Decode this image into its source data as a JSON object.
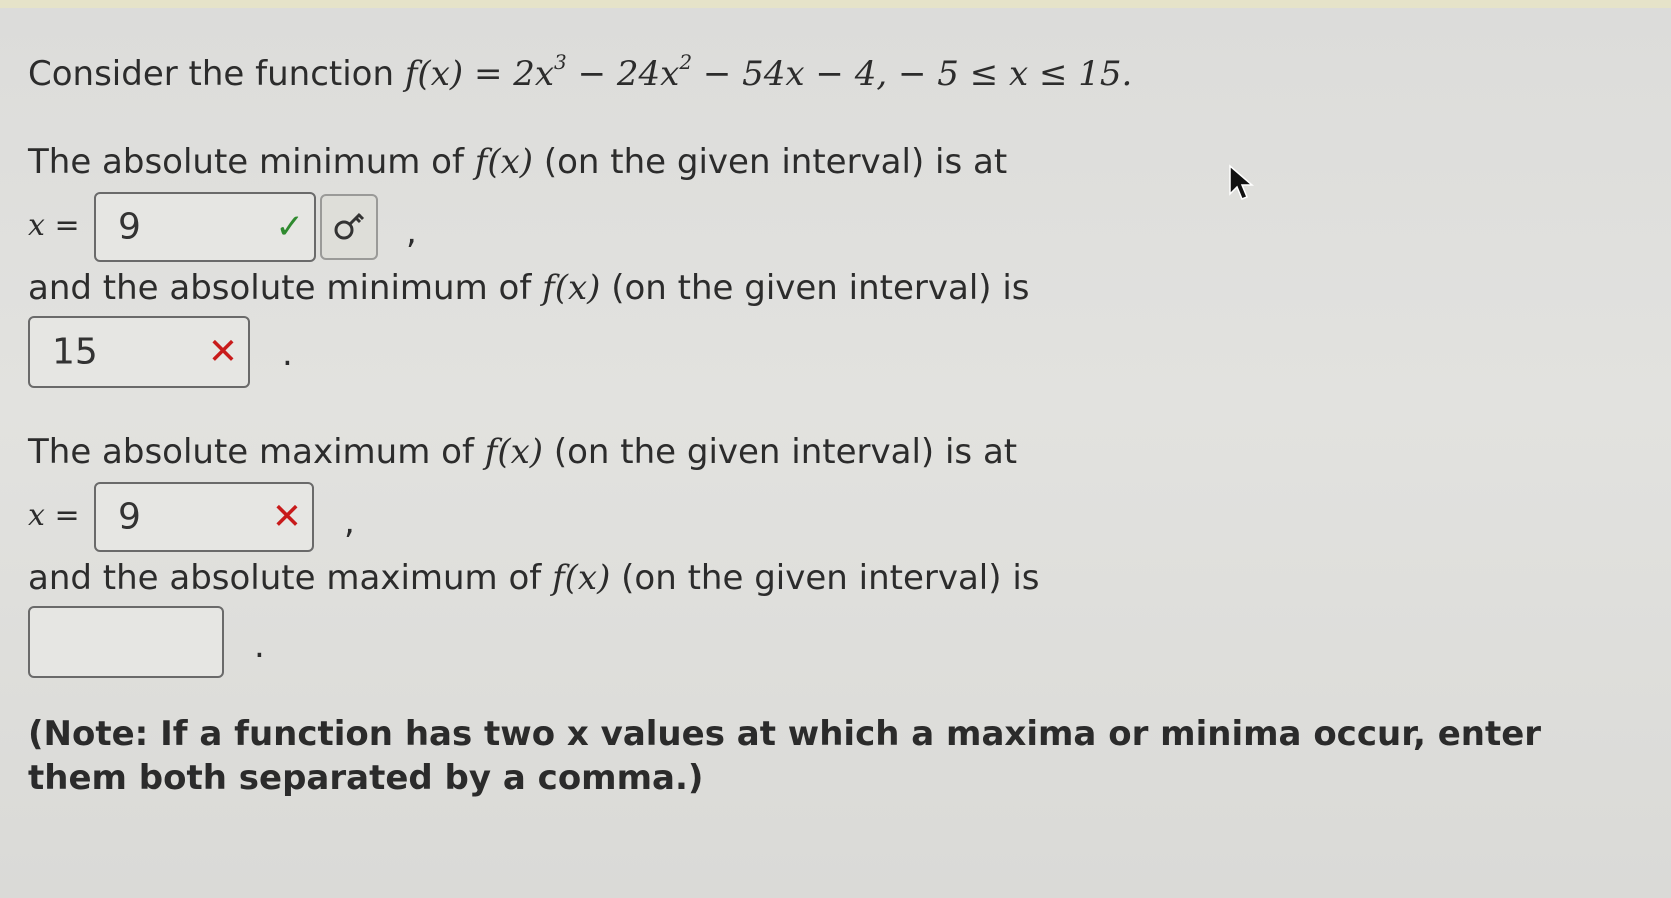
{
  "intro": {
    "prefix": "Consider the function ",
    "fx": "f(x) = 2x",
    "exp1": "3",
    "mid1": " − 24x",
    "exp2": "2",
    "mid2": " − 54x − 4,   − 5 ≤ x ≤ 15."
  },
  "q1": {
    "text_before": "The absolute minimum of ",
    "fx": "f(x)",
    "text_after": " (on the given interval) is at",
    "x_label": "x",
    "equals": " =",
    "answer": "9",
    "status_mark": "✓",
    "key_icon": "key-icon",
    "trailing_punct": ","
  },
  "q2": {
    "text_before": "and the absolute minimum of ",
    "fx": "f(x)",
    "text_after": " (on the given interval) is",
    "answer": "15",
    "status_mark": "✕",
    "trailing_punct": "."
  },
  "q3": {
    "text_before": "The absolute maximum of ",
    "fx": "f(x)",
    "text_after": " (on the given interval) is at",
    "x_label": "x",
    "equals": " =",
    "answer": "9",
    "status_mark": "✕",
    "trailing_punct": ","
  },
  "q4": {
    "text_before": "and the absolute maximum of ",
    "fx": "f(x)",
    "text_after": " (on the given interval) is",
    "answer": "",
    "trailing_punct": "."
  },
  "note": "(Note: If a function has two x values at which a maxima or minima occur, enter them both separated by a comma.)",
  "colors": {
    "correct": "#2f8a2f",
    "incorrect": "#c81b1b",
    "background": "#dedddb"
  },
  "icons": {
    "cursor": "mouse-pointer-icon",
    "check": "checkmark-icon",
    "cross": "cross-icon",
    "key": "key-icon"
  }
}
